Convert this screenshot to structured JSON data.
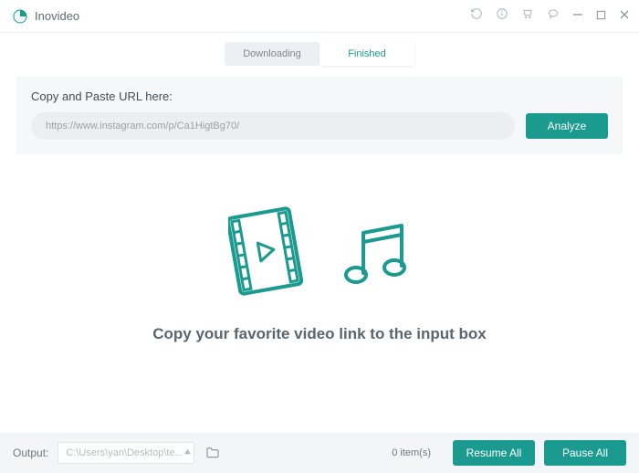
{
  "app": {
    "name": "Inovideo"
  },
  "tabs": {
    "downloading": "Downloading",
    "finished": "Finished",
    "active": "finished"
  },
  "url_panel": {
    "label": "Copy and Paste URL here:",
    "value": "https://www.instagram.com/p/Ca1HigtBg70/",
    "analyze_label": "Analyze"
  },
  "empty": {
    "message": "Copy your favorite video link to the input box"
  },
  "bottom": {
    "output_label": "Output:",
    "output_path": "C:\\Users\\yan\\Desktop\\te...",
    "count": "0 item(s)",
    "resume_label": "Resume All",
    "pause_label": "Pause All"
  },
  "colors": {
    "accent": "#1b9a8f"
  }
}
